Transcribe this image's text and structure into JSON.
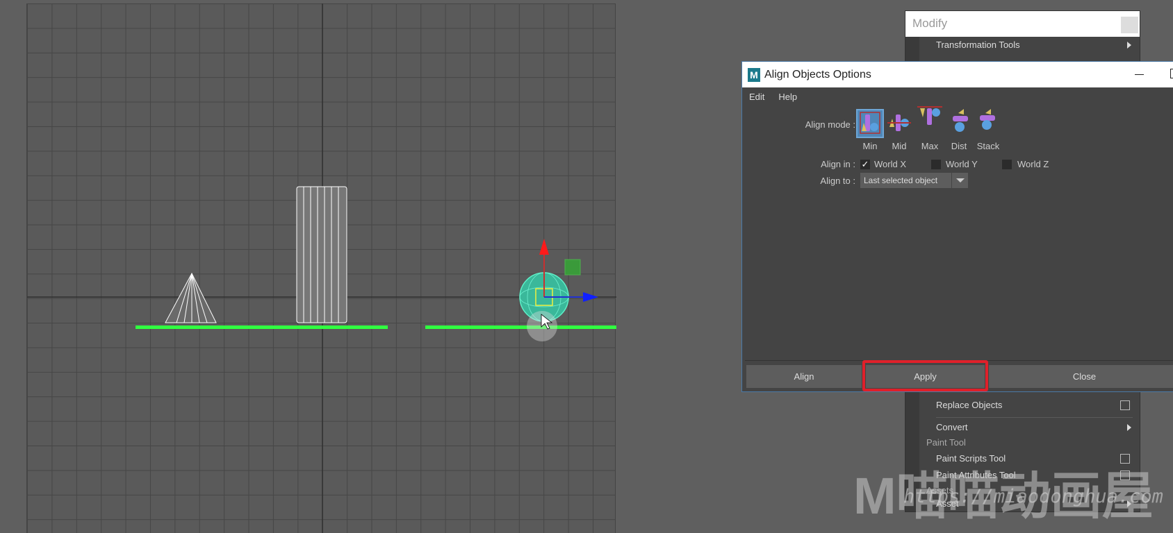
{
  "modify_menu": {
    "title": "Modify",
    "items": [
      {
        "label": "Transformation Tools",
        "type": "submenu"
      },
      {
        "label": "Replace Objects",
        "type": "option"
      },
      {
        "label": "Convert",
        "type": "submenu"
      }
    ],
    "sections": {
      "paint": "Paint Tool",
      "assets": "Assets"
    },
    "paint_items": [
      {
        "label": "Paint Scripts Tool"
      },
      {
        "label": "Paint Attributes Tool"
      }
    ],
    "asset_item": "Asset"
  },
  "dialog": {
    "title": "Align Objects Options",
    "menu": [
      "Edit",
      "Help"
    ],
    "align_mode_label": "Align mode :",
    "modes": [
      {
        "label": "Min",
        "selected": true
      },
      {
        "label": "Mid"
      },
      {
        "label": "Max"
      },
      {
        "label": "Dist"
      },
      {
        "label": "Stack"
      }
    ],
    "align_in_label": "Align in :",
    "axes": [
      {
        "label": "World X",
        "checked": true
      },
      {
        "label": "World Y",
        "checked": false
      },
      {
        "label": "World Z",
        "checked": false
      }
    ],
    "align_to_label": "Align to :",
    "align_to_value": "Last selected object",
    "buttons": {
      "align": "Align",
      "apply": "Apply",
      "close": "Close"
    }
  },
  "watermark": {
    "text": "M喵喵动画屋",
    "url": "https://miaodonghua.com"
  },
  "colors": {
    "highlight": "#e0202a",
    "selection": "#30ff40",
    "accent": "#4b7aa8"
  }
}
